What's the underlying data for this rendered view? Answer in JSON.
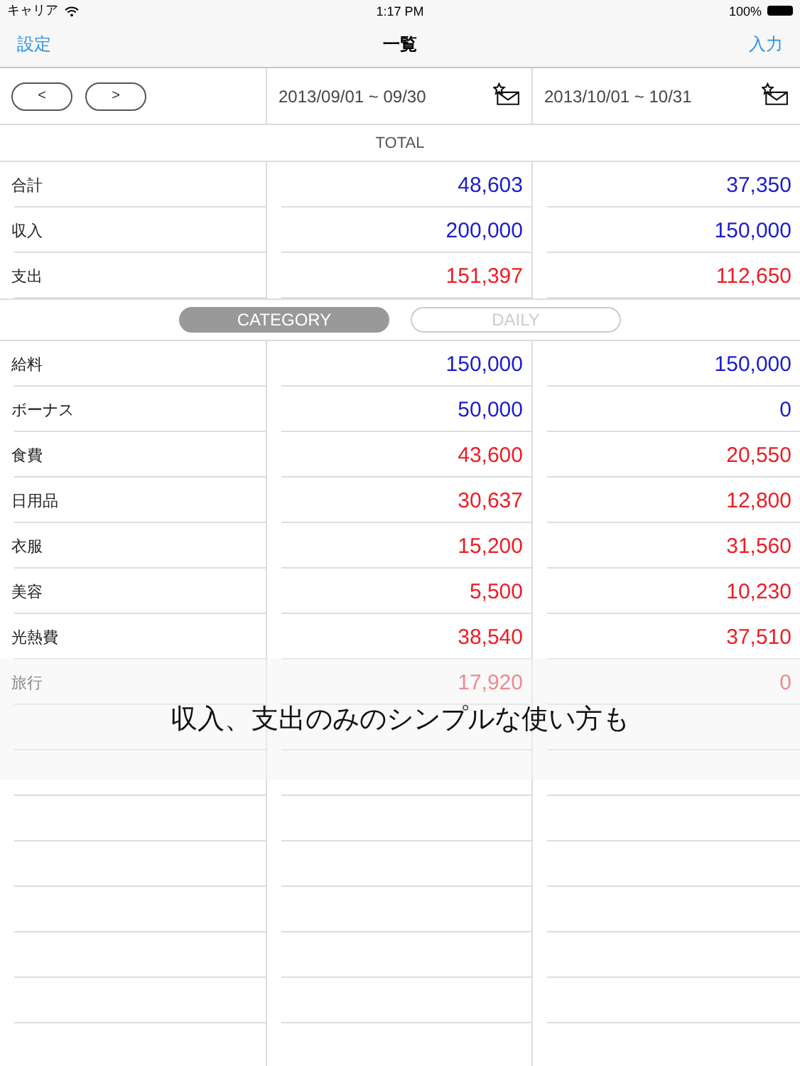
{
  "status_bar": {
    "carrier": "キャリア",
    "time": "1:17 PM",
    "battery": "100%"
  },
  "nav": {
    "left": "設定",
    "title": "一覧",
    "right": "入力"
  },
  "periods": {
    "prev": "<",
    "next": ">",
    "columns": [
      "2013/09/01 ~ 09/30",
      "2013/10/01 ~ 10/31"
    ]
  },
  "total_header": "TOTAL",
  "totals": [
    {
      "label": "合計",
      "kind": "income",
      "values": [
        "48,603",
        "37,350"
      ]
    },
    {
      "label": "収入",
      "kind": "income",
      "values": [
        "200,000",
        "150,000"
      ]
    },
    {
      "label": "支出",
      "kind": "expense",
      "values": [
        "151,397",
        "112,650"
      ]
    }
  ],
  "segments": [
    {
      "label": "CATEGORY",
      "selected": true
    },
    {
      "label": "DAILY",
      "selected": false
    }
  ],
  "categories": [
    {
      "label": "給料",
      "kind": "income",
      "values": [
        "150,000",
        "150,000"
      ]
    },
    {
      "label": "ボーナス",
      "kind": "income",
      "values": [
        "50,000",
        "0"
      ]
    },
    {
      "label": "食費",
      "kind": "expense",
      "values": [
        "43,600",
        "20,550"
      ]
    },
    {
      "label": "日用品",
      "kind": "expense",
      "values": [
        "30,637",
        "12,800"
      ]
    },
    {
      "label": "衣服",
      "kind": "expense",
      "values": [
        "15,200",
        "31,560"
      ]
    },
    {
      "label": "美容",
      "kind": "expense",
      "values": [
        "5,500",
        "10,230"
      ]
    },
    {
      "label": "光熱費",
      "kind": "expense",
      "values": [
        "38,540",
        "37,510"
      ]
    },
    {
      "label": "旅行",
      "kind": "expense",
      "values": [
        "17,920",
        "0"
      ]
    }
  ],
  "caption": "収入、支出のみのシンプルな使い方も"
}
